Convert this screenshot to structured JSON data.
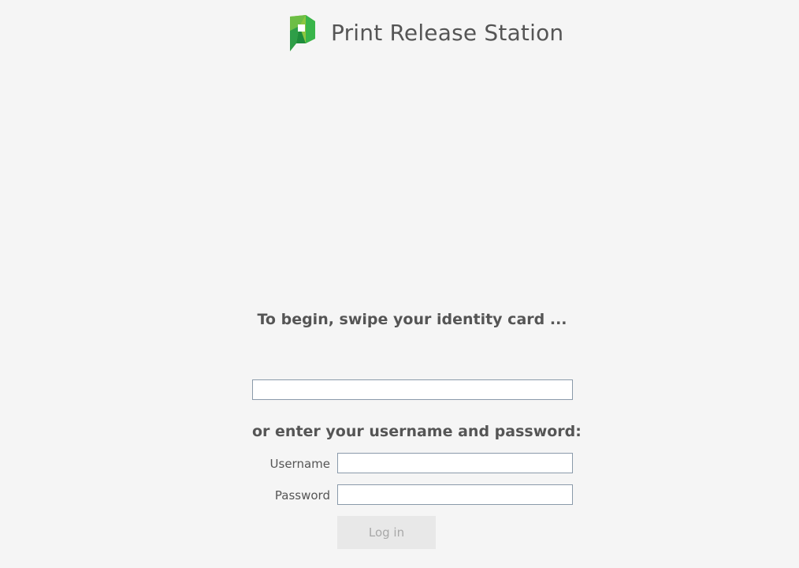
{
  "app": {
    "title": "Print Release Station",
    "logo_icon": "papercut-logo-icon",
    "brand_colors": {
      "green_light": "#8cc63f",
      "green": "#39b54a",
      "green_dark": "#1e8c3c",
      "background": "#f5f5f5",
      "text": "#555555"
    }
  },
  "swipe": {
    "prompt": "To begin, swipe your identity card ...",
    "card_value": ""
  },
  "login": {
    "prompt": "or enter your username and password:",
    "username_label": "Username",
    "username_value": "",
    "password_label": "Password",
    "password_value": "",
    "button_label": "Log in"
  }
}
